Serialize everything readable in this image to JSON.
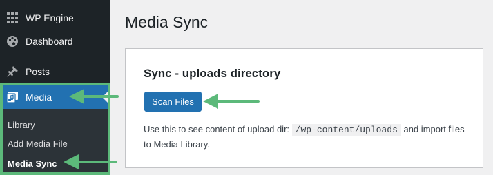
{
  "sidebar": {
    "items": [
      {
        "label": "WP Engine",
        "icon": "grid-icon"
      },
      {
        "label": "Dashboard",
        "icon": "palette-icon"
      },
      {
        "label": "Posts",
        "icon": "pin-icon"
      }
    ],
    "media": {
      "label": "Media",
      "icon": "media-icon",
      "submenu": [
        "Library",
        "Add Media File",
        "Media Sync"
      ],
      "current": "Media Sync"
    }
  },
  "main": {
    "title": "Media Sync",
    "panel": {
      "title": "Sync - uploads directory",
      "button_label": "Scan Files",
      "description_before": "Use this to see content of upload dir:",
      "description_code": "/wp-content/uploads",
      "description_after": "and import files to Media Library."
    }
  },
  "colors": {
    "sidebar_bg": "#1d2327",
    "accent": "#2271b1",
    "highlight": "#5cb97a",
    "page_bg": "#f0f0f1"
  }
}
